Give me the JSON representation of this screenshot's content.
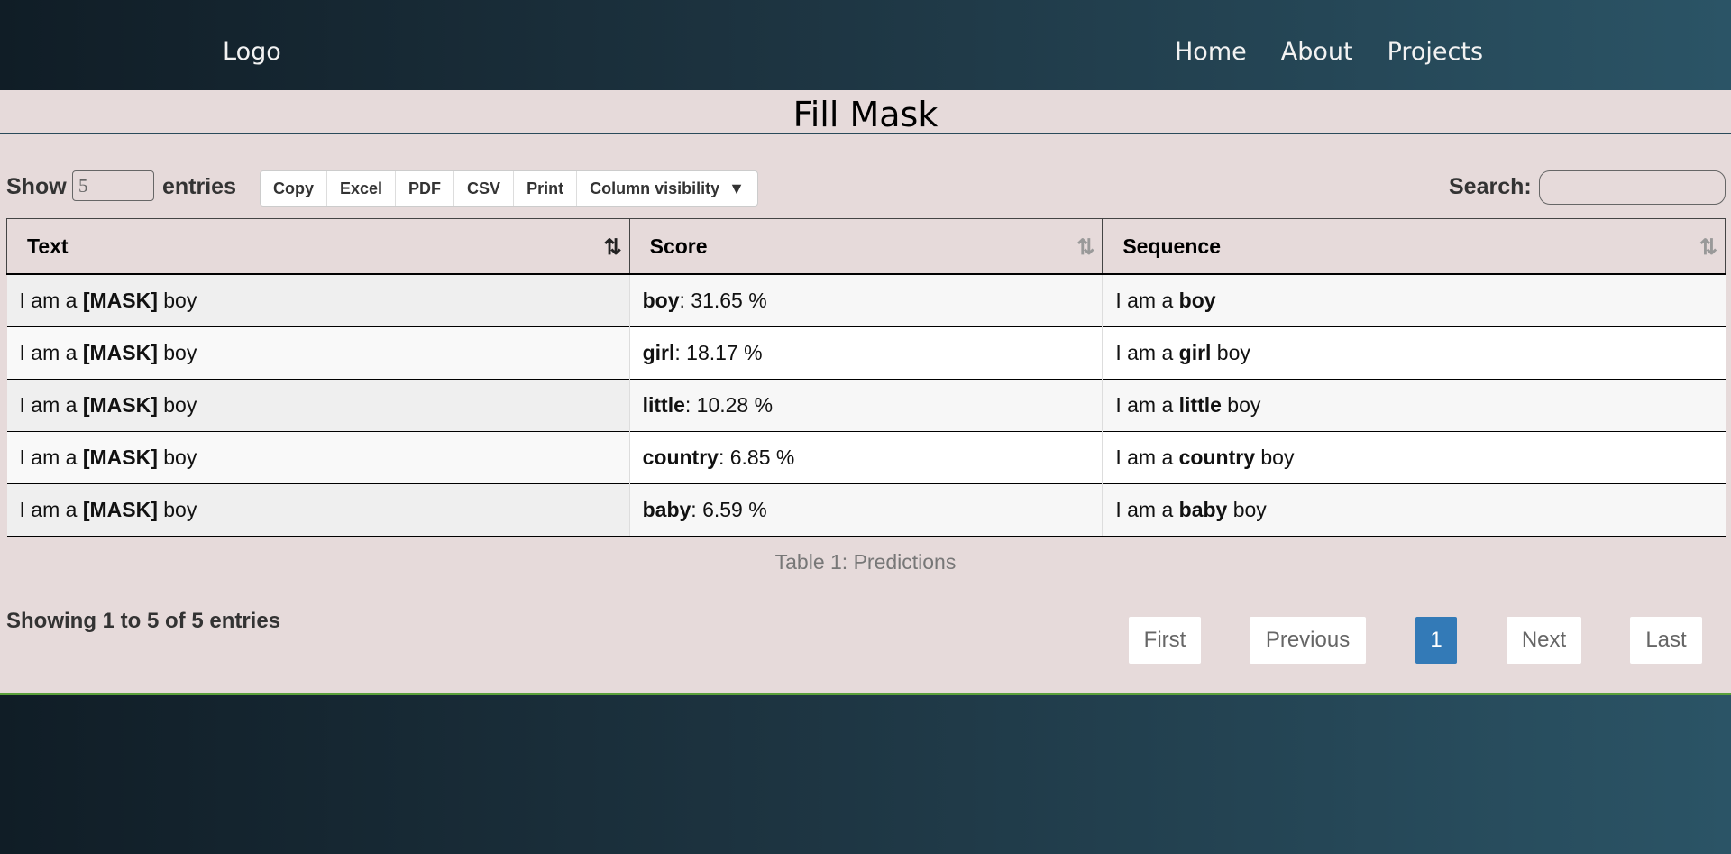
{
  "nav": {
    "logo": "Logo",
    "links": [
      "Home",
      "About",
      "Projects"
    ]
  },
  "page": {
    "title": "Fill Mask"
  },
  "controls": {
    "show_label": "Show",
    "length_value": "5",
    "entries_label": "entries",
    "buttons": [
      "Copy",
      "Excel",
      "PDF",
      "CSV",
      "Print",
      "Column visibility"
    ],
    "search_label": "Search:"
  },
  "table": {
    "columns": [
      "Text",
      "Score",
      "Sequence"
    ],
    "rows": [
      {
        "text_pre": "I am a ",
        "text_mask": "[MASK]",
        "text_post": " boy",
        "token": "boy",
        "score": ": 31.65 %",
        "seq_pre": "I am a ",
        "seq_token": "boy",
        "seq_post": ""
      },
      {
        "text_pre": "I am a ",
        "text_mask": "[MASK]",
        "text_post": " boy",
        "token": "girl",
        "score": ": 18.17 %",
        "seq_pre": "I am a ",
        "seq_token": "girl",
        "seq_post": " boy"
      },
      {
        "text_pre": "I am a ",
        "text_mask": "[MASK]",
        "text_post": " boy",
        "token": "little",
        "score": ": 10.28 %",
        "seq_pre": "I am a ",
        "seq_token": "little",
        "seq_post": " boy"
      },
      {
        "text_pre": "I am a ",
        "text_mask": "[MASK]",
        "text_post": " boy",
        "token": "country",
        "score": ": 6.85 %",
        "seq_pre": "I am a ",
        "seq_token": "country",
        "seq_post": " boy"
      },
      {
        "text_pre": "I am a ",
        "text_mask": "[MASK]",
        "text_post": " boy",
        "token": "baby",
        "score": ": 6.59 %",
        "seq_pre": "I am a ",
        "seq_token": "baby",
        "seq_post": " boy"
      }
    ],
    "caption": "Table 1: Predictions",
    "info": "Showing 1 to 5 of 5 entries"
  },
  "pagination": {
    "first": "First",
    "previous": "Previous",
    "current": "1",
    "next": "Next",
    "last": "Last"
  },
  "colors": {
    "accent": "#337ab7",
    "panel_bg": "#e6dada",
    "nav_dark": "#101d26",
    "nav_light": "#2b5466"
  }
}
